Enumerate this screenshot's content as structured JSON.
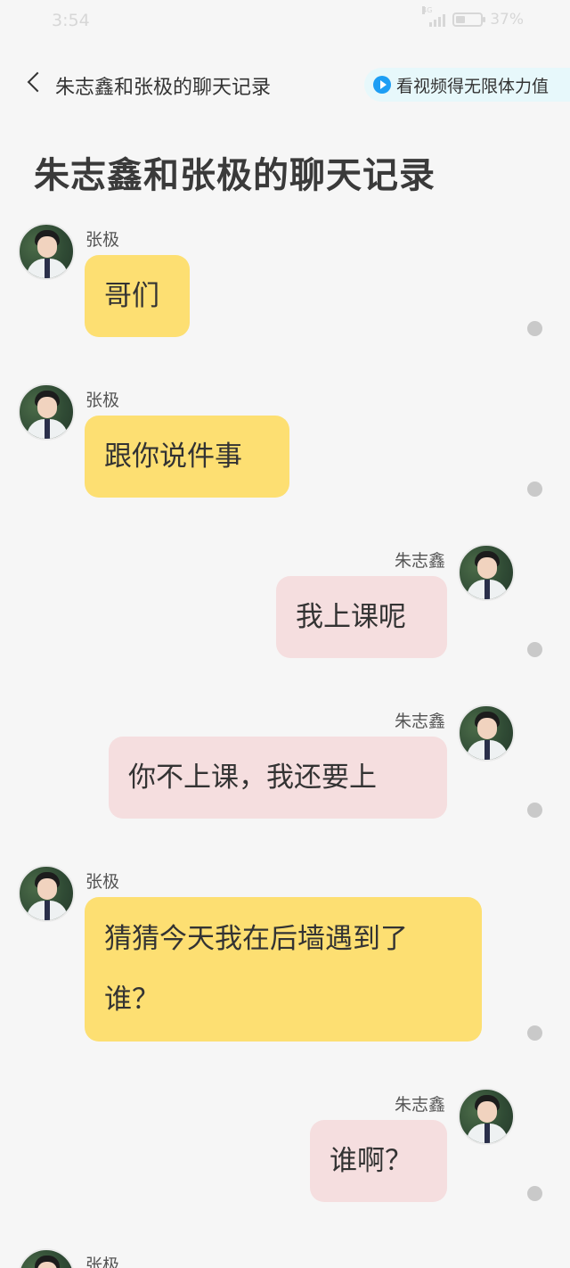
{
  "status_bar": {
    "time": "3:54",
    "network": "4G",
    "battery": "37%",
    "battery_level": 0.37
  },
  "nav": {
    "back_title": "朱志鑫和张极的聊天记录",
    "promo": "看视频得无限体力值"
  },
  "page_title": "朱志鑫和张极的聊天记录",
  "messages": [
    {
      "sender": "张极",
      "side": "left",
      "text": "哥们"
    },
    {
      "sender": "张极",
      "side": "left",
      "text": "跟你说件事"
    },
    {
      "sender": "朱志鑫",
      "side": "right",
      "text": "我上课呢"
    },
    {
      "sender": "朱志鑫",
      "side": "right",
      "text": "你不上课，我还要上"
    },
    {
      "sender": "张极",
      "side": "left",
      "text": "猜猜今天我在后墙遇到了谁？"
    },
    {
      "sender": "朱志鑫",
      "side": "right",
      "text": "谁啊？"
    },
    {
      "sender": "张极",
      "side": "left",
      "text": ""
    }
  ],
  "colors": {
    "left_bubble": "#fddf72",
    "right_bubble": "#f5dedf",
    "background": "#f6f6f6",
    "promo_background": "#e7f8fb",
    "play_icon": "#1e9ef4"
  },
  "icons": [
    "back-arrow-icon",
    "play-icon",
    "signal-icon",
    "battery-icon",
    "more-dot-icon"
  ]
}
